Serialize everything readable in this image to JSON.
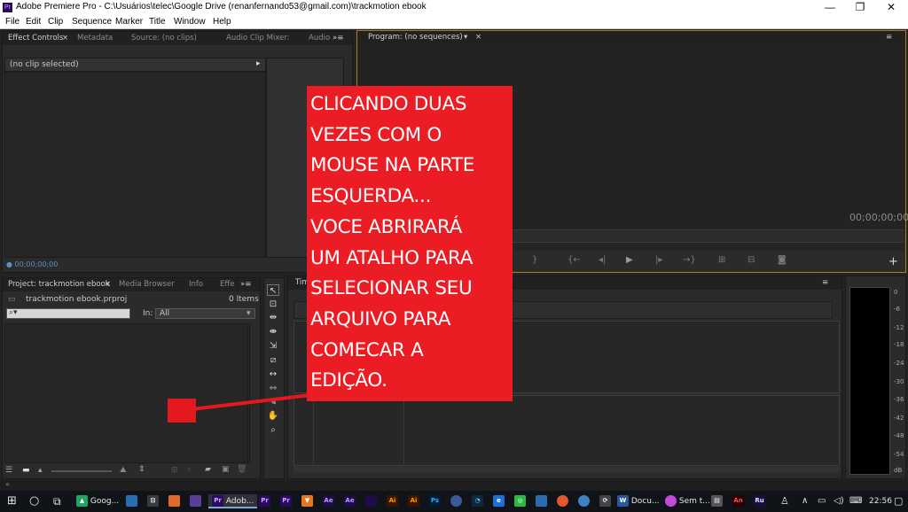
{
  "window": {
    "title": "Adobe Premiere Pro - C:\\Usuários\\telec\\Google Drive (renanfernando53@gmail.com)\\trackmotion ebook",
    "app_icon": "Pr",
    "controls": {
      "minimize": "—",
      "restore": "❐",
      "close": "✕"
    }
  },
  "menu": [
    "File",
    "Edit",
    "Clip",
    "Sequence",
    "Marker",
    "Title",
    "Window",
    "Help"
  ],
  "source_panel": {
    "tabs": [
      "Effect Controls",
      "Metadata",
      "Source: (no clips)",
      "Audio Clip Mixer:",
      "Audio"
    ],
    "clip_status": "(no clip selected)",
    "timecode": "00;00;00;00"
  },
  "program_monitor": {
    "tab": "Program: (no sequences)",
    "timecode": "00;00;00;00"
  },
  "project_panel": {
    "tabs": [
      "Project: trackmotion ebook",
      "Media Browser",
      "Info",
      "Effe"
    ],
    "project_file": "trackmotion ebook.prproj",
    "items_count": "0 Items",
    "search_placeholder": "",
    "in_label": "In:",
    "in_value": "All"
  },
  "timeline": {
    "tab": "Tim"
  },
  "audio_meter": {
    "scale": [
      "0",
      "-6",
      "-12",
      "-18",
      "-24",
      "-30",
      "-36",
      "-42",
      "-48",
      "-54",
      "dB"
    ]
  },
  "annotation": {
    "lines": [
      "CLICANDO DUAS",
      "VEZES COM O",
      "MOUSE NA PARTE",
      "ESQUERDA...",
      "VOCE ABRIRARÁ",
      "UM ATALHO PARA",
      "SELECIONAR SEU",
      "ARQUIVO PARA",
      "COMECAR A",
      "EDIÇÃO."
    ],
    "color": "#ec1c24"
  },
  "taskbar": {
    "items": [
      {
        "label": "Goog..."
      },
      {
        "label": "Adob..."
      },
      {
        "label": "Docu..."
      },
      {
        "label": "Sem t..."
      }
    ],
    "clock": "22:56"
  }
}
